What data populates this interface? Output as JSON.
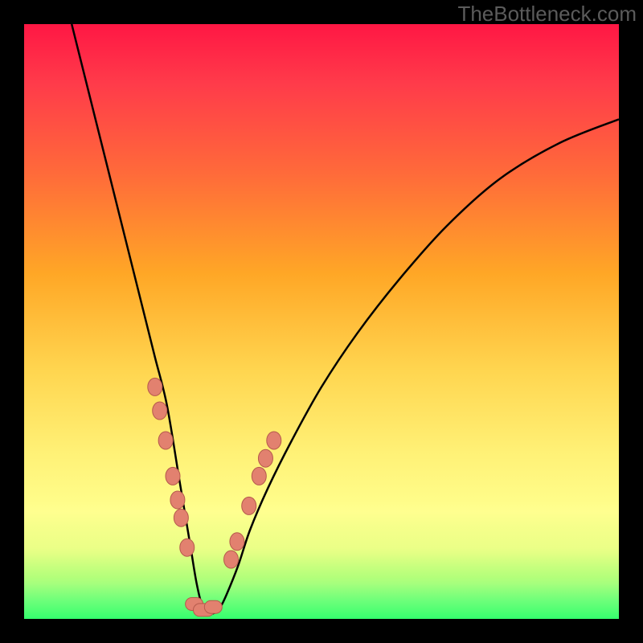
{
  "watermark": "TheBottleneck.com",
  "colors": {
    "outer_frame": "#000000",
    "curve": "#000000",
    "marker_fill": "#e2816f",
    "marker_stroke": "#b55a4c",
    "gradient_top": "#ff1744",
    "gradient_bottom": "#35ff6b"
  },
  "chart_data": {
    "type": "line",
    "title": "",
    "xlabel": "",
    "ylabel": "",
    "xlim": [
      0,
      100
    ],
    "ylim": [
      0,
      100
    ],
    "curve_description": "V-shaped bottleneck-style curve; steep left arm, pointed valley near x≈30, shallower rising right arm",
    "series": [
      {
        "name": "curve",
        "x": [
          8,
          10,
          12,
          14,
          16,
          18,
          20,
          22,
          24,
          26,
          27,
          28,
          29,
          30,
          31,
          32,
          33,
          34,
          36,
          38,
          41,
          45,
          50,
          56,
          63,
          71,
          80,
          90,
          100
        ],
        "y": [
          100,
          92,
          84,
          76,
          68,
          60,
          52,
          44,
          36,
          24,
          18,
          12,
          6,
          2,
          1,
          1,
          2,
          4,
          9,
          15,
          22,
          30,
          39,
          48,
          57,
          66,
          74,
          80,
          84
        ]
      }
    ],
    "markers": {
      "left_arm": {
        "x": [
          22.0,
          22.8,
          23.8,
          25.0,
          25.8,
          26.4,
          27.4
        ],
        "y": [
          39,
          35,
          30,
          24,
          20,
          17,
          12
        ]
      },
      "valley": {
        "x": [
          28.6,
          30.2,
          31.8
        ],
        "y": [
          2.5,
          1.5,
          2.0
        ]
      },
      "right_arm": {
        "x": [
          34.8,
          35.8,
          37.8,
          39.5,
          40.6,
          42.0
        ],
        "y": [
          10,
          13,
          19,
          24,
          27,
          30
        ]
      }
    }
  }
}
